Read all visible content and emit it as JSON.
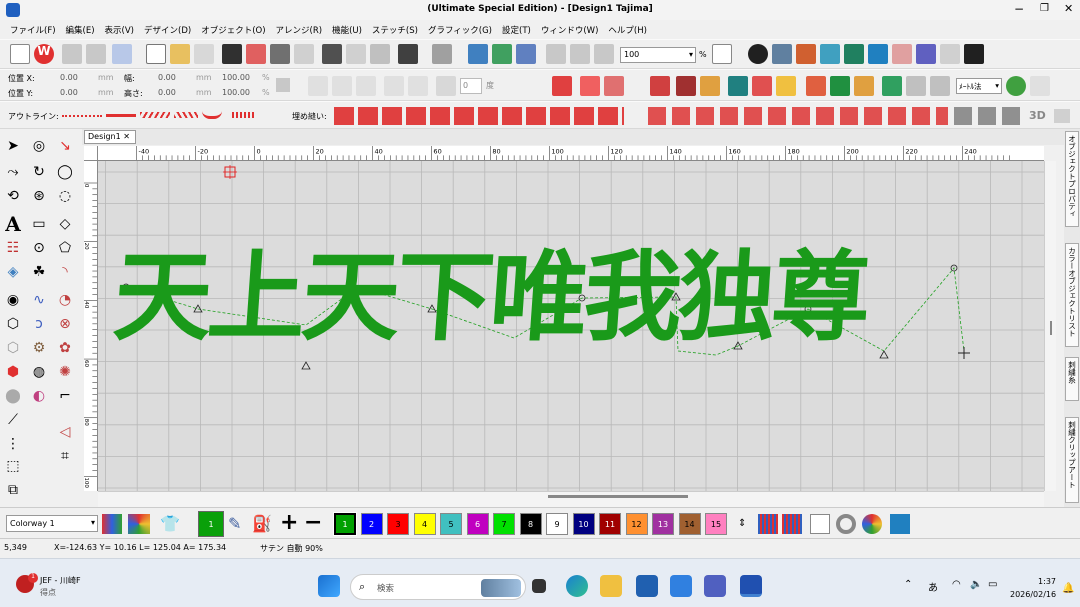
{
  "window": {
    "title": "(Ultimate Special Edition) - [Design1        Tajima]"
  },
  "menu": [
    "ファイル(F)",
    "編集(E)",
    "表示(V)",
    "デザイン(D)",
    "オブジェクト(O)",
    "アレンジ(R)",
    "機能(U)",
    "ステッチ(S)",
    "グラフィック(G)",
    "設定(T)",
    "ウィンドウ(W)",
    "ヘルプ(H)"
  ],
  "toolbar": {
    "zoom": "100",
    "zoom_unit": "%"
  },
  "position": {
    "pos_x_label": "位置 X:",
    "pos_x": "0.00",
    "pos_x_unit": "mm",
    "pos_y_label": "位置 Y:",
    "pos_y": "0.00",
    "pos_y_unit": "mm",
    "width_label": "幅:",
    "width": "0.00",
    "width_unit": "mm",
    "width_pct": "100.00",
    "width_pct_unit": "%",
    "height_label": "高さ:",
    "height": "0.00",
    "height_unit": "mm",
    "height_pct": "100.00",
    "height_pct_unit": "%",
    "rotation": "0",
    "rotation_unit": "度"
  },
  "outline_label": "アウトライン:",
  "fill_label": "埋め縫い:",
  "fill_method": "ﾒｰﾄﾙ法",
  "three_d": "3D",
  "doc_tab": "Design1",
  "ruler_h": [
    "-40",
    "-20",
    "0",
    "20",
    "40",
    "60",
    "80",
    "100",
    "120",
    "140",
    "160",
    "180",
    "200",
    "220",
    "240"
  ],
  "ruler_v": [
    "0",
    "20",
    "40",
    "60",
    "80",
    "100"
  ],
  "design_text": [
    "天",
    "上",
    "天",
    "下",
    "唯",
    "我",
    "独",
    "尊"
  ],
  "right_panels": [
    "オブジェクトプロパティ",
    "カラーオブジェクトリスト",
    "刺繍糸",
    "刺繍クリップアート"
  ],
  "colorway": "Colorway 1",
  "current_color": "1",
  "swatches": [
    {
      "n": "1",
      "c": "#00a000"
    },
    {
      "n": "2",
      "c": "#0000ff"
    },
    {
      "n": "3",
      "c": "#ff0000"
    },
    {
      "n": "4",
      "c": "#ffff00"
    },
    {
      "n": "5",
      "c": "#40c0c0"
    },
    {
      "n": "6",
      "c": "#c000c0"
    },
    {
      "n": "7",
      "c": "#00e000"
    },
    {
      "n": "8",
      "c": "#000000"
    },
    {
      "n": "9",
      "c": "#ffffff"
    },
    {
      "n": "10",
      "c": "#000080"
    },
    {
      "n": "11",
      "c": "#a00000"
    },
    {
      "n": "12",
      "c": "#ff9030"
    },
    {
      "n": "13",
      "c": "#a030a0"
    },
    {
      "n": "14",
      "c": "#a06030"
    },
    {
      "n": "15",
      "c": "#ff80c0"
    }
  ],
  "status": {
    "stitches": "5,349",
    "coords": "X=-124.63 Y=  10.16 L= 125.04 A= 175.34",
    "mode": "サテン 自動 90%"
  },
  "taskbar": {
    "weather_temp": "1",
    "weather_line1": "JEF - 川崎F",
    "weather_line2": "得点",
    "search_placeholder": "検索",
    "ime": "あ",
    "time": "1:37",
    "date": "2026/02/16"
  }
}
